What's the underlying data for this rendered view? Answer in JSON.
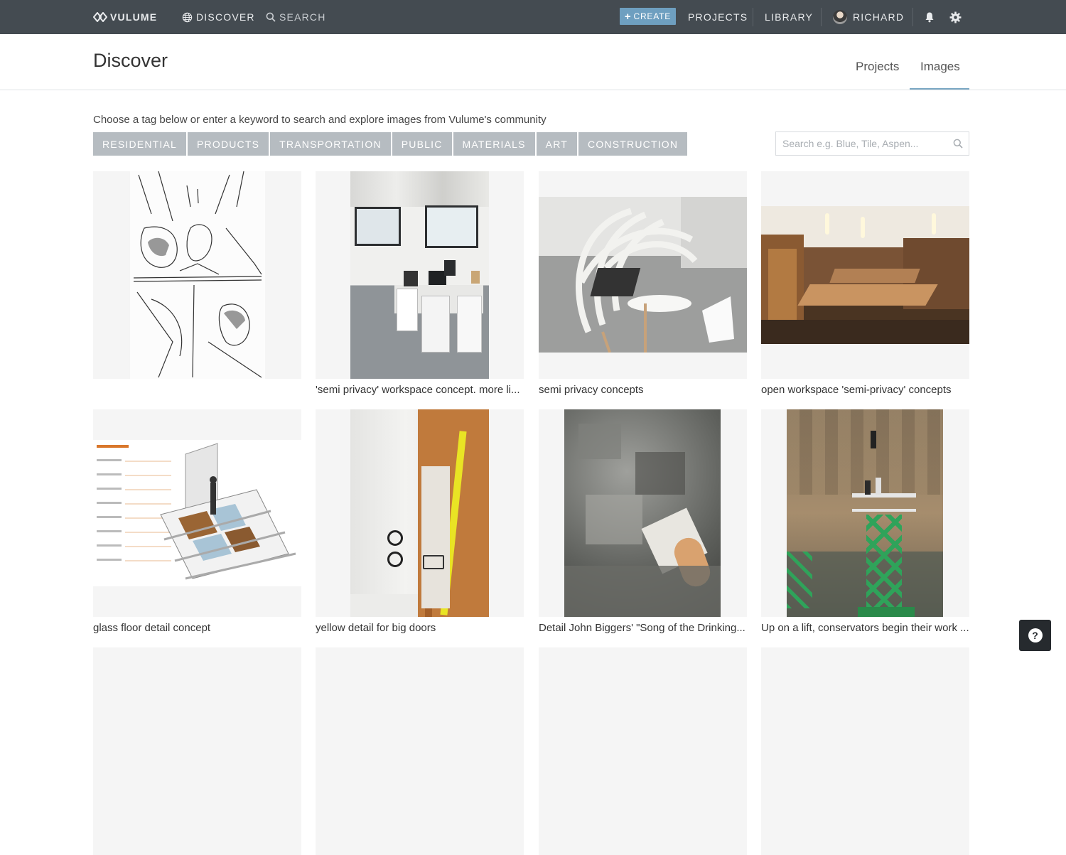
{
  "topbar": {
    "logo": "VULUME",
    "discover": "DISCOVER",
    "search": "SEARCH",
    "create": "CREATE",
    "projects": "PROJECTS",
    "library": "LIBRARY",
    "user": "RICHARD",
    "icons": [
      "vulume-logo-icon",
      "globe-icon",
      "search-icon",
      "plus-icon",
      "avatar",
      "bell-icon",
      "gear-icon"
    ]
  },
  "header": {
    "title": "Discover",
    "tabs": [
      {
        "label": "Projects",
        "active": false
      },
      {
        "label": "Images",
        "active": true
      }
    ],
    "active_color": "#7aa8c4"
  },
  "intro": "Choose a tag below or enter a keyword to search and explore images from Vulume's community",
  "tags": [
    "RESIDENTIAL",
    "PRODUCTS",
    "TRANSPORTATION",
    "PUBLIC",
    "MATERIALS",
    "ART",
    "CONSTRUCTION"
  ],
  "search": {
    "placeholder": "Search e.g. Blue, Tile, Aspen..."
  },
  "cards": [
    {
      "caption": "",
      "image": "storyboard sketch"
    },
    {
      "caption": "'semi privacy' workspace concept. more li...",
      "image": "office interior"
    },
    {
      "caption": "semi privacy concepts",
      "image": "wooden slat chair pod"
    },
    {
      "caption": "open workspace 'semi-privacy' concepts",
      "image": "long wooden table workspace"
    },
    {
      "caption": "glass floor detail concept",
      "image": "floor structure diagram"
    },
    {
      "caption": "yellow detail for big doors",
      "image": "hallway with yellow door"
    },
    {
      "caption": "Detail John Biggers' \"Song of the Drinking...",
      "image": "mural detail"
    },
    {
      "caption": "Up on a lift, conservators begin their work ...",
      "image": "conservators on scissor lift"
    }
  ],
  "help": "?",
  "colors": {
    "topbar": "#444b51",
    "create": "#6e9fc0",
    "tag": "#b6bcc1"
  }
}
